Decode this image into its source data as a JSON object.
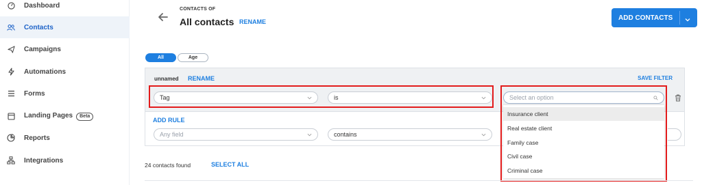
{
  "sidebar": {
    "items": [
      {
        "label": "Dashboard",
        "icon": "dashboard-icon"
      },
      {
        "label": "Contacts",
        "icon": "contacts-icon",
        "active": true
      },
      {
        "label": "Campaigns",
        "icon": "send-icon"
      },
      {
        "label": "Automations",
        "icon": "automation-icon"
      },
      {
        "label": "Forms",
        "icon": "forms-icon"
      },
      {
        "label": "Landing Pages",
        "icon": "landing-page-icon",
        "badge": "Beta"
      },
      {
        "label": "Reports",
        "icon": "reports-icon"
      },
      {
        "label": "Integrations",
        "icon": "integrations-icon"
      }
    ]
  },
  "header": {
    "eyebrow": "CONTACTS OF",
    "title": "All contacts",
    "rename_label": "RENAME",
    "add_contacts_label": "ADD CONTACTS"
  },
  "segments": [
    {
      "label": "All",
      "active": true
    },
    {
      "label": "Age",
      "active": false
    }
  ],
  "filter": {
    "name": "unnamed",
    "rename_label": "RENAME",
    "save_label": "SAVE FILTER",
    "rule1": {
      "field": "Tag",
      "operator": "is",
      "value_placeholder": "Select an option"
    },
    "add_rule_label": "ADD RULE",
    "rule2": {
      "field_placeholder": "Any field",
      "operator": "contains"
    }
  },
  "dropdown": {
    "options": [
      "Insurance client",
      "Real estate client",
      "Family case",
      "Civil case",
      "Criminal case"
    ]
  },
  "results": {
    "count_text": "24 contacts found",
    "select_all_label": "SELECT ALL"
  },
  "colors": {
    "accent": "#1e7fe0",
    "highlight_box": "#e31b1b",
    "active_nav_bg": "#eef3f9"
  }
}
